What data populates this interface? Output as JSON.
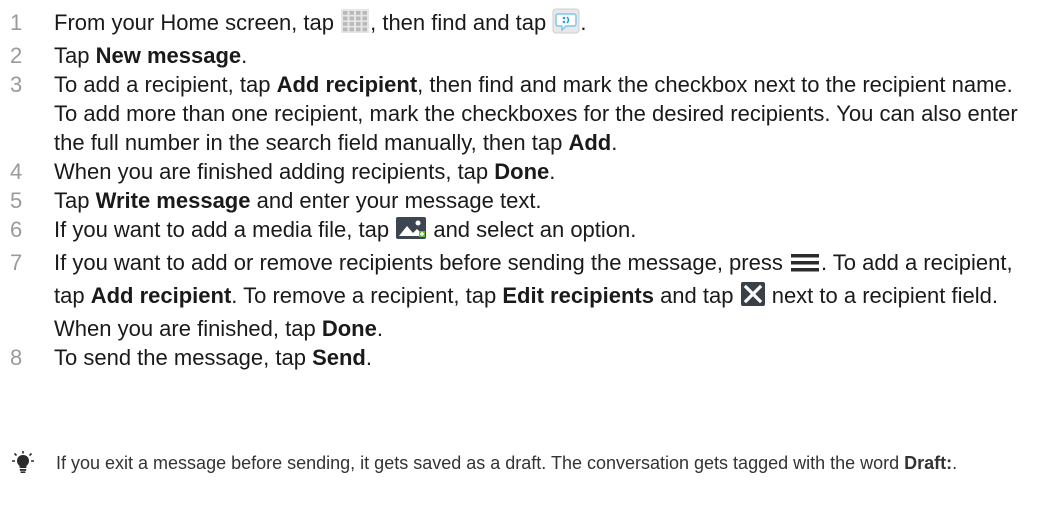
{
  "steps": [
    {
      "num": "1",
      "parts": [
        {
          "t": "text",
          "v": "From your Home screen, tap "
        },
        {
          "t": "icon",
          "v": "apps-grid-icon"
        },
        {
          "t": "text",
          "v": ", then find and tap "
        },
        {
          "t": "icon",
          "v": "messaging-icon"
        },
        {
          "t": "text",
          "v": "."
        }
      ]
    },
    {
      "num": "2",
      "parts": [
        {
          "t": "text",
          "v": "Tap "
        },
        {
          "t": "bold",
          "v": "New message"
        },
        {
          "t": "text",
          "v": "."
        }
      ]
    },
    {
      "num": "3",
      "parts": [
        {
          "t": "text",
          "v": "To add a recipient, tap "
        },
        {
          "t": "bold",
          "v": "Add recipient"
        },
        {
          "t": "text",
          "v": ", then find and mark the checkbox next to the recipient name. To add more than one recipient, mark the checkboxes for the desired recipients. You can also enter the full number in the search field manually, then tap "
        },
        {
          "t": "bold",
          "v": "Add"
        },
        {
          "t": "text",
          "v": "."
        }
      ]
    },
    {
      "num": "4",
      "parts": [
        {
          "t": "text",
          "v": "When you are finished adding recipients, tap "
        },
        {
          "t": "bold",
          "v": "Done"
        },
        {
          "t": "text",
          "v": "."
        }
      ]
    },
    {
      "num": "5",
      "parts": [
        {
          "t": "text",
          "v": "Tap "
        },
        {
          "t": "bold",
          "v": "Write message"
        },
        {
          "t": "text",
          "v": " and enter your message text."
        }
      ]
    },
    {
      "num": "6",
      "parts": [
        {
          "t": "text",
          "v": "If you want to add a media file, tap "
        },
        {
          "t": "icon",
          "v": "attach-media-icon"
        },
        {
          "t": "text",
          "v": " and select an option."
        }
      ]
    },
    {
      "num": "7",
      "parts": [
        {
          "t": "text",
          "v": "If you want to add or remove recipients before sending the message, press "
        },
        {
          "t": "icon",
          "v": "menu-icon"
        },
        {
          "t": "text",
          "v": ". To add a recipient, tap "
        },
        {
          "t": "bold",
          "v": "Add recipient"
        },
        {
          "t": "text",
          "v": ". To remove a recipient, tap "
        },
        {
          "t": "bold",
          "v": "Edit recipients"
        },
        {
          "t": "text",
          "v": " and tap "
        },
        {
          "t": "icon",
          "v": "remove-icon"
        },
        {
          "t": "text",
          "v": " next to a recipient field. When you are finished, tap "
        },
        {
          "t": "bold",
          "v": "Done"
        },
        {
          "t": "text",
          "v": "."
        }
      ]
    },
    {
      "num": "8",
      "parts": [
        {
          "t": "text",
          "v": "To send the message, tap "
        },
        {
          "t": "bold",
          "v": "Send"
        },
        {
          "t": "text",
          "v": "."
        }
      ]
    }
  ],
  "tip": {
    "icon": "tip-lightbulb-icon",
    "parts": [
      {
        "t": "text",
        "v": "If you exit a message before sending, it gets saved as a draft. The conversation gets tagged with the word "
      },
      {
        "t": "bold",
        "v": "Draft:"
      },
      {
        "t": "text",
        "v": "."
      }
    ]
  }
}
